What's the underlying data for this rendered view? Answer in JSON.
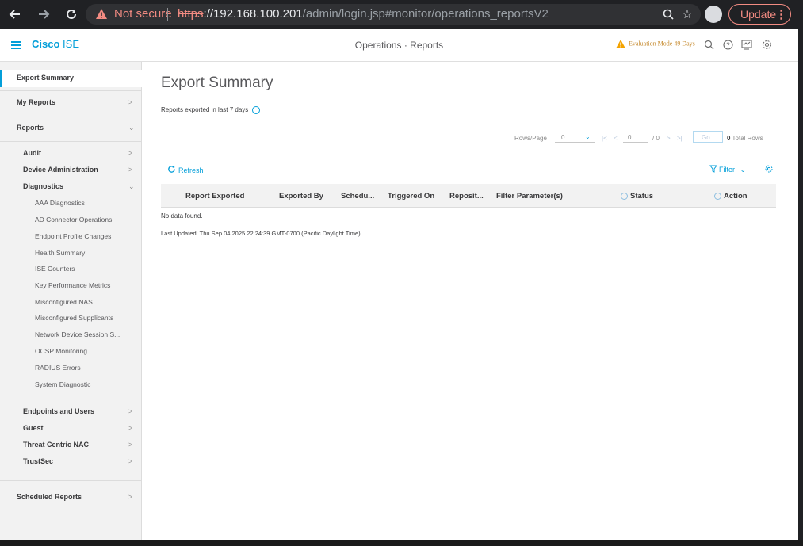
{
  "browser": {
    "not_secure": "Not secure",
    "url_scheme": "https",
    "url_host": "://192.168.100.201",
    "url_path": "/admin/login.jsp#monitor/operations_reportsV2",
    "update_label": "Update"
  },
  "header": {
    "brand_bold": "Cisco",
    "brand_rest": "ISE",
    "breadcrumb": "Operations · Reports",
    "evaluation": "Evaluation Mode 49 Days"
  },
  "sidebar": {
    "export_summary": "Export Summary",
    "my_reports": "My Reports",
    "reports": "Reports",
    "audit": "Audit",
    "device_admin": "Device Administration",
    "diagnostics": "Diagnostics",
    "diagnostics_items": [
      "AAA Diagnostics",
      "AD Connector Operations",
      "Endpoint Profile Changes",
      "Health Summary",
      "ISE Counters",
      "Key Performance Metrics",
      "Misconfigured NAS",
      "Misconfigured Supplicants",
      "Network Device Session S...",
      "OCSP Monitoring",
      "RADIUS Errors",
      "System Diagnostic"
    ],
    "endpoints_users": "Endpoints and Users",
    "guest": "Guest",
    "threat_centric": "Threat Centric NAC",
    "trustsec": "TrustSec",
    "scheduled_reports": "Scheduled Reports"
  },
  "main": {
    "title": "Export Summary",
    "subtitle": "Reports exported in last 7 days",
    "pager": {
      "rows_label": "Rows/Page",
      "rows_value": "0",
      "page_value": "0",
      "page_total": "/ 0",
      "go_label": "Go",
      "total_count": "0",
      "total_label": "Total Rows"
    },
    "refresh_label": "Refresh",
    "filter_label": "Filter",
    "columns": [
      "Report Exported",
      "Exported By",
      "Schedu...",
      "Triggered On",
      "Reposit...",
      "Filter Parameter(s)",
      "Status",
      "Action"
    ],
    "no_data": "No data found.",
    "last_updated": "Last Updated: Thu Sep 04 2025 22:24:39 GMT-0700 (Pacific Daylight Time)"
  },
  "colors": {
    "cisco_blue": "#049fd9",
    "warning": "#f4a300",
    "not_secure_red": "#f28b82"
  },
  "icons": {
    "back": "arrow-left-icon",
    "forward": "arrow-right-icon",
    "reload": "reload-icon",
    "warning": "warning-triangle-icon",
    "zoom": "zoom-icon",
    "bookmark": "star-icon",
    "menu": "hamburger-icon",
    "search": "search-icon",
    "help": "help-icon",
    "notifications": "notification-icon",
    "settings": "gear-icon",
    "refresh": "refresh-icon",
    "filter": "filter-icon",
    "info": "info-icon"
  }
}
